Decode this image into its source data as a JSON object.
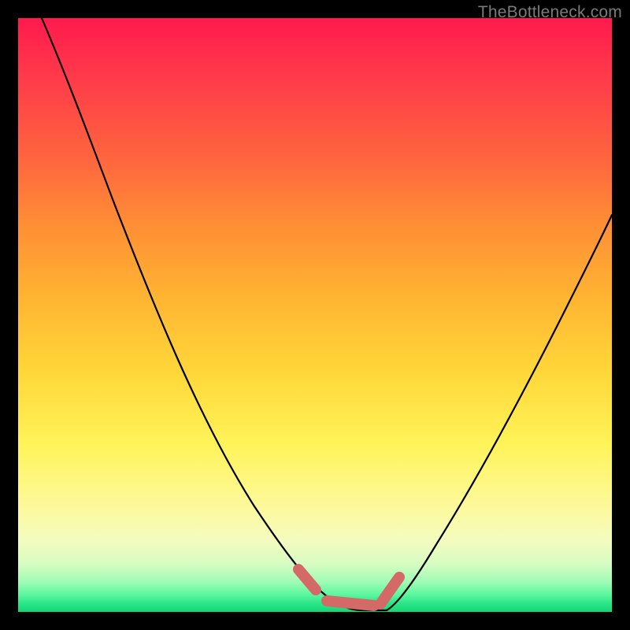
{
  "watermark": "TheBottleneck.com",
  "colors": {
    "gradient_top": "#ff1a4d",
    "gradient_mid": "#ffd83a",
    "gradient_bottom": "#12d776",
    "curve": "#000000",
    "marker": "#d46a68",
    "frame": "#000000"
  },
  "chart_data": {
    "type": "line",
    "title": "",
    "xlabel": "",
    "ylabel": "",
    "xlim": [
      0,
      100
    ],
    "ylim": [
      0,
      100
    ],
    "grid": false,
    "legend": false,
    "series": [
      {
        "name": "bottleneck-curve",
        "x": [
          4,
          10,
          16,
          22,
          28,
          34,
          40,
          44,
          48,
          52,
          55,
          58,
          62,
          68,
          74,
          80,
          86,
          92,
          98,
          100
        ],
        "values": [
          100,
          88,
          74,
          61,
          48,
          36,
          24,
          16,
          9,
          4,
          1,
          0,
          0,
          3,
          9,
          18,
          28,
          40,
          52,
          56
        ]
      }
    ],
    "markers": [
      {
        "name": "optimal-range",
        "x_start": 48,
        "x_end": 63,
        "y": 0.5
      }
    ]
  }
}
